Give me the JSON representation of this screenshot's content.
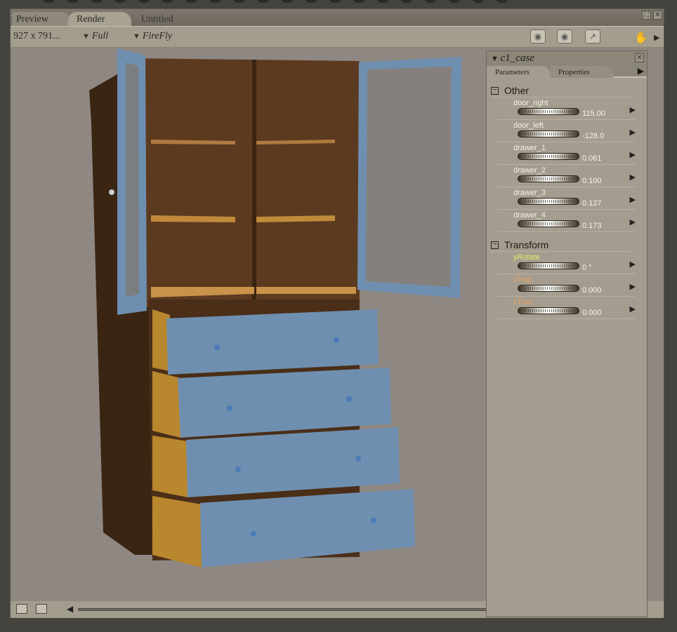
{
  "window": {
    "tabs": [
      "Preview",
      "Render"
    ],
    "title": "Untitled"
  },
  "toolbar": {
    "resolution": "927 x 791...",
    "quality": "Full",
    "renderer": "FireFly"
  },
  "panel": {
    "title": "c1_case",
    "tabs": [
      "Parameters",
      "Properties"
    ],
    "groups": [
      {
        "name": "Other",
        "params": [
          {
            "label": "door_right",
            "value": "115.00"
          },
          {
            "label": "door_left",
            "value": "-128.0"
          },
          {
            "label": "drawer_1",
            "value": "0.061"
          },
          {
            "label": "drawer_2",
            "value": "0.100"
          },
          {
            "label": "drawer_3",
            "value": "0.127"
          },
          {
            "label": "drawer_4",
            "value": "0.173"
          }
        ]
      },
      {
        "name": "Transform",
        "params": [
          {
            "label": "yRotate",
            "value": "0 °",
            "color": "#e8e86a"
          },
          {
            "label": "xTran",
            "value": "0.000",
            "color": "#e8a060"
          },
          {
            "label": "zTran",
            "value": "0.000",
            "color": "#e8a060"
          }
        ]
      }
    ]
  },
  "colors": {
    "wood": "#5a3a22",
    "drawer": "#6f8fb0",
    "inner": "#c08a3a"
  }
}
